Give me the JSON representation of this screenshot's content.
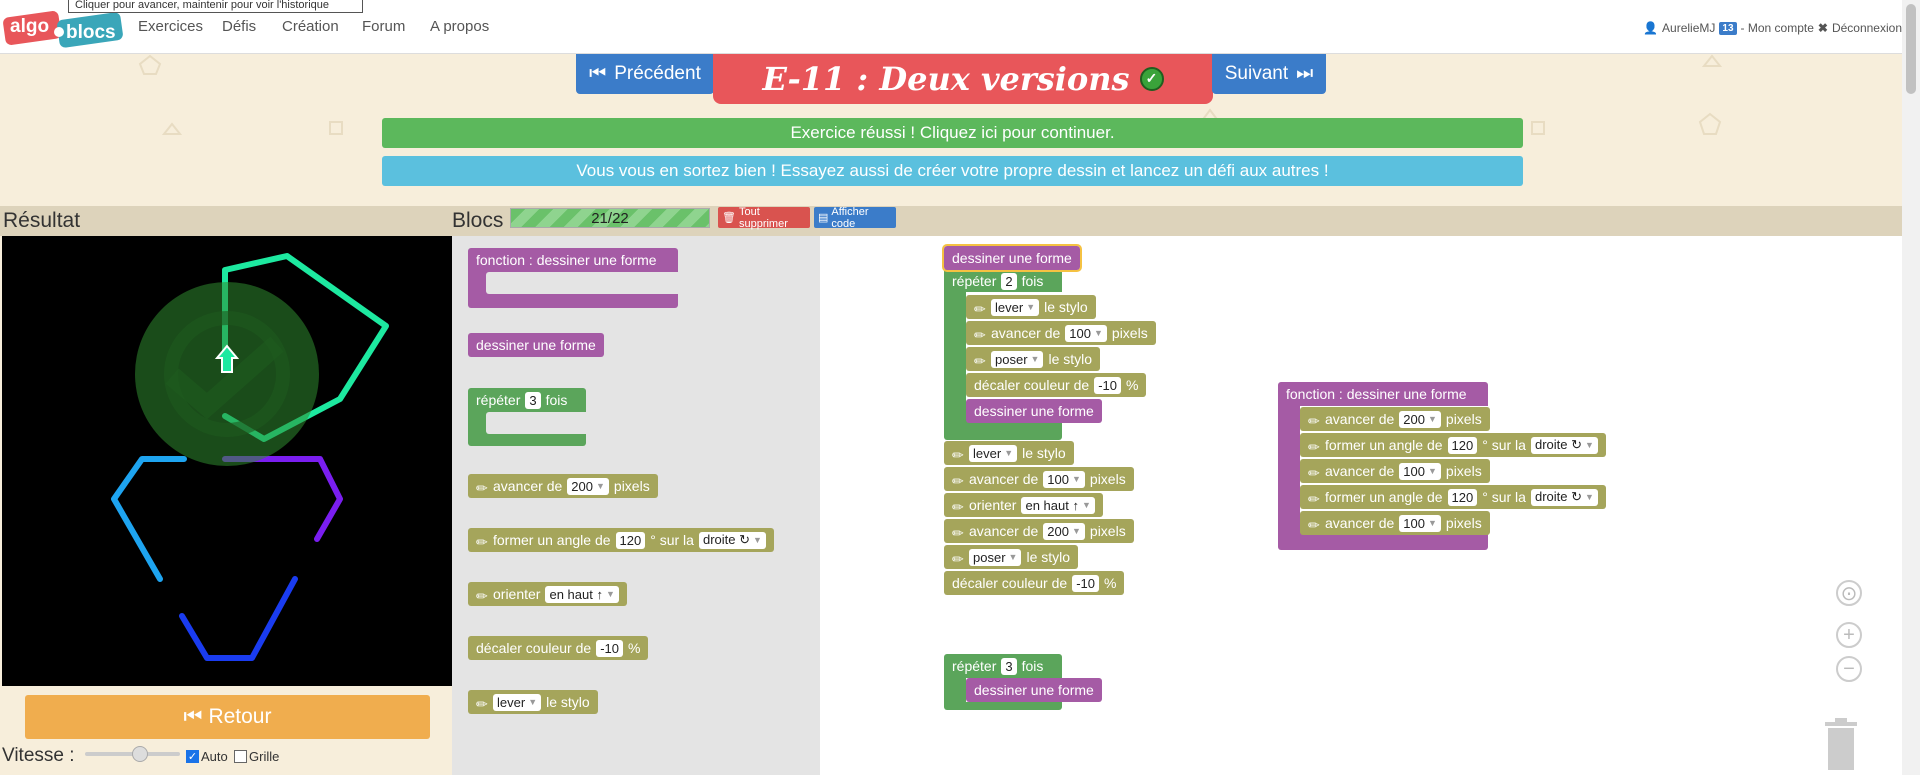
{
  "nav": {
    "logo_top": "algo",
    "logo_bottom": "blocs",
    "tooltip": "Cliquer pour avancer, maintenir pour voir l'historique",
    "links": [
      "Exercices",
      "Défis",
      "Création",
      "Forum",
      "A propos"
    ],
    "user": "AurelieMJ",
    "badge": "13",
    "account": "- Mon compte",
    "logout": "Déconnexion"
  },
  "header": {
    "prev": "Précédent",
    "next": "Suivant",
    "title": "E-11 : Deux versions",
    "msg_success": "Exercice réussi ! Cliquez ici pour continuer.",
    "msg_info": "Vous vous en sortez bien ! Essayez aussi de créer votre propre dessin et lancez un défi aux autres !"
  },
  "panels": {
    "result_title": "Résultat",
    "blocs_title": "Blocs",
    "progress": "21/22",
    "progress_fraction": 0.9545,
    "delete_all": "Tout supprimer",
    "show_code": "Afficher code"
  },
  "controls": {
    "retour": "Retour",
    "vitesse": "Vitesse :",
    "speed_level": 0.65,
    "auto": "Auto",
    "auto_checked": true,
    "grille": "Grille",
    "grille_checked": false
  },
  "toolbox": {
    "b1": "fonction : dessiner une forme",
    "b2": "dessiner une forme",
    "b3_pre": "répéter",
    "b3_val": "3",
    "b3_post": "fois",
    "b4_pre": "avancer de",
    "b4_val": "200",
    "b4_post": "pixels",
    "b5_pre": "former un angle de",
    "b5_val": "120",
    "b5_mid": "° sur la",
    "b5_dir": "droite ↻",
    "b6_pre": "orienter",
    "b6_val": "en haut ↑",
    "b7_pre": "décaler couleur de",
    "b7_val": "-10",
    "b7_post": "%",
    "b8_val": "lever",
    "b8_post": "le stylo"
  },
  "workspace": {
    "main": {
      "hat": "dessiner une forme",
      "repeat1_pre": "répéter",
      "repeat1_val": "2",
      "repeat1_post": "fois",
      "s1_val": "lever",
      "s1_post": "le stylo",
      "s2_pre": "avancer de",
      "s2_val": "100",
      "s2_post": "pixels",
      "s3_val": "poser",
      "s3_post": "le stylo",
      "s4_pre": "décaler couleur de",
      "s4_val": "-10",
      "s4_post": "%",
      "s5": "dessiner une forme",
      "t1_val": "lever",
      "t1_post": "le stylo",
      "t2_pre": "avancer de",
      "t2_val": "100",
      "t2_post": "pixels",
      "t3_pre": "orienter",
      "t3_val": "en haut ↑",
      "t4_pre": "avancer de",
      "t4_val": "200",
      "t4_post": "pixels",
      "t5_val": "poser",
      "t5_post": "le stylo",
      "t6_pre": "décaler couleur de",
      "t6_val": "-10",
      "t6_post": "%",
      "repeat2_pre": "répéter",
      "repeat2_val": "3",
      "repeat2_post": "fois",
      "r2_inner": "dessiner une forme"
    },
    "func": {
      "hat": "fonction : dessiner une forme",
      "f1_pre": "avancer de",
      "f1_val": "200",
      "f1_post": "pixels",
      "f2_pre": "former un angle de",
      "f2_val": "120",
      "f2_mid": "° sur la",
      "f2_dir": "droite ↻",
      "f3_pre": "avancer de",
      "f3_val": "100",
      "f3_post": "pixels",
      "f4_pre": "former un angle de",
      "f4_val": "120",
      "f4_mid": "° sur la",
      "f4_dir": "droite ↻",
      "f5_pre": "avancer de",
      "f5_val": "100",
      "f5_post": "pixels"
    }
  }
}
